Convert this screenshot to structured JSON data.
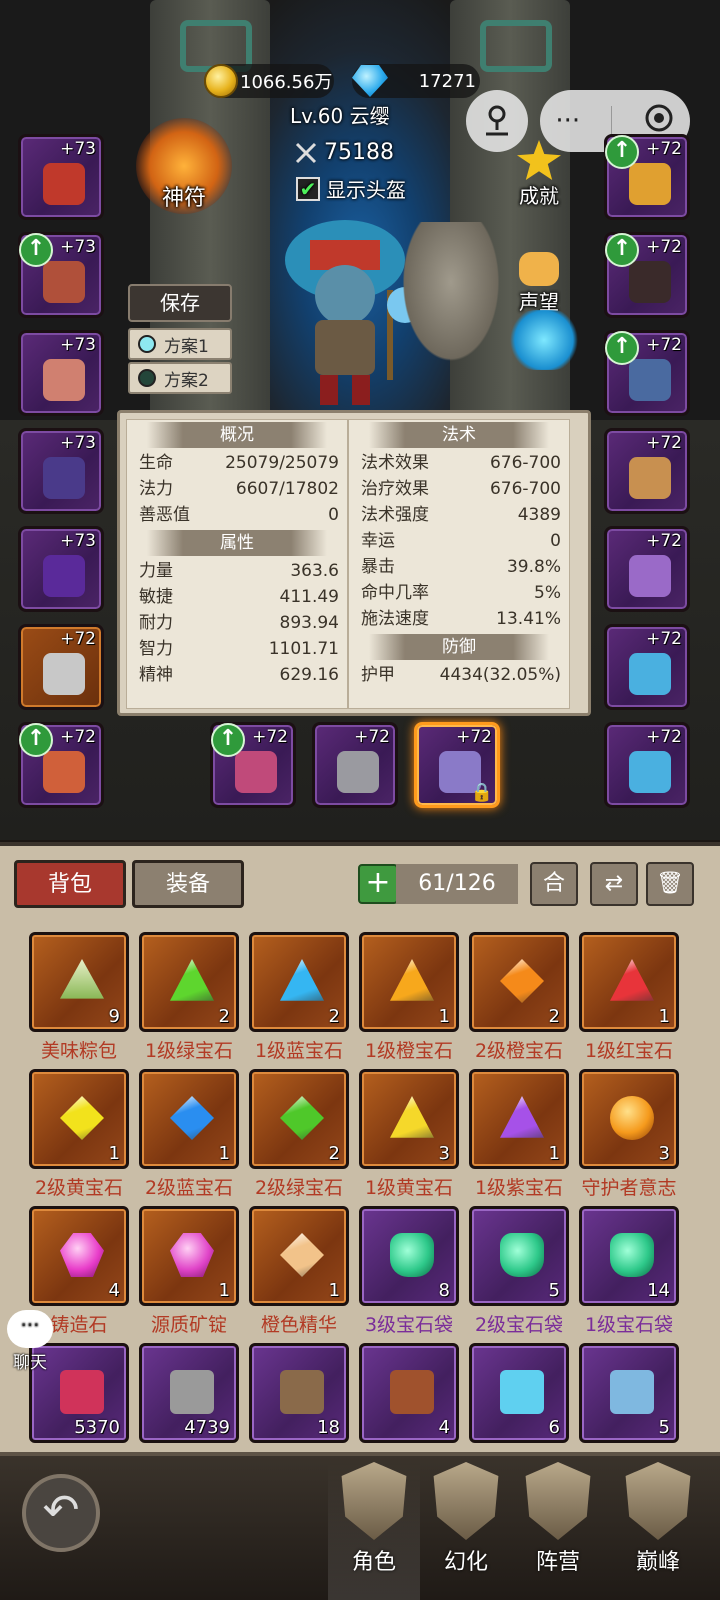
{
  "currency": {
    "gold": "1066.56万",
    "diamond": "17271"
  },
  "player": {
    "level_name": "Lv.60 云缨",
    "power": "75188",
    "show_helmet_label": "显示头盔"
  },
  "buttons": {
    "talisman": "神符",
    "achievement": "成就",
    "reputation": "声望",
    "save": "保存",
    "plan1": "方案1",
    "plan2": "方案2",
    "more": "···"
  },
  "left_equipment": [
    {
      "plus": "+73",
      "up": false,
      "rarity": "purple",
      "icon": "glove-icon"
    },
    {
      "plus": "+73",
      "up": true,
      "rarity": "purple",
      "icon": "necklace-icon"
    },
    {
      "plus": "+73",
      "up": false,
      "rarity": "purple",
      "icon": "bracer-icon"
    },
    {
      "plus": "+73",
      "up": false,
      "rarity": "purple",
      "icon": "armor-icon"
    },
    {
      "plus": "+73",
      "up": false,
      "rarity": "purple",
      "icon": "cape-icon"
    },
    {
      "plus": "+72",
      "up": false,
      "rarity": "orange",
      "icon": "bracelet-icon"
    },
    {
      "plus": "+72",
      "up": true,
      "rarity": "purple",
      "icon": "gauntlet-icon"
    }
  ],
  "right_equipment": [
    {
      "plus": "+72",
      "up": true,
      "rarity": "purple",
      "icon": "shoulder-icon"
    },
    {
      "plus": "+72",
      "up": true,
      "rarity": "purple",
      "icon": "pants-icon"
    },
    {
      "plus": "+72",
      "up": true,
      "rarity": "purple",
      "icon": "boots-icon"
    },
    {
      "plus": "+72",
      "up": false,
      "rarity": "purple",
      "icon": "ring-icon"
    },
    {
      "plus": "+72",
      "up": false,
      "rarity": "purple",
      "icon": "ring2-icon"
    },
    {
      "plus": "+72",
      "up": false,
      "rarity": "purple",
      "icon": "amulet-icon"
    },
    {
      "plus": "+72",
      "up": false,
      "rarity": "purple",
      "icon": "amulet2-icon"
    }
  ],
  "weapons": [
    {
      "plus": "+72",
      "up": true,
      "icon": "sword-icon"
    },
    {
      "plus": "+72",
      "up": false,
      "icon": "dagger-icon"
    },
    {
      "plus": "+72",
      "up": false,
      "icon": "staff-icon",
      "selected": true,
      "locked": true
    }
  ],
  "stats": {
    "overview_title": "概况",
    "overview": [
      {
        "label": "生命",
        "value": "25079/25079"
      },
      {
        "label": "法力",
        "value": "6607/17802"
      },
      {
        "label": "善恶值",
        "value": "0"
      }
    ],
    "attributes_title": "属性",
    "attributes": [
      {
        "label": "力量",
        "value": "363.6"
      },
      {
        "label": "敏捷",
        "value": "411.49"
      },
      {
        "label": "耐力",
        "value": "893.94"
      },
      {
        "label": "智力",
        "value": "1101.71"
      },
      {
        "label": "精神",
        "value": "629.16"
      }
    ],
    "magic_title": "法术",
    "magic": [
      {
        "label": "法术效果",
        "value": "676-700"
      },
      {
        "label": "治疗效果",
        "value": "676-700"
      },
      {
        "label": "法术强度",
        "value": "4389"
      },
      {
        "label": "幸运",
        "value": "0"
      },
      {
        "label": "暴击",
        "value": "39.8%"
      },
      {
        "label": "命中几率",
        "value": "5%"
      },
      {
        "label": "施法速度",
        "value": "13.41%"
      }
    ],
    "defense_title": "防御",
    "defense": [
      {
        "label": "护甲",
        "value": "4434(32.05%)"
      }
    ]
  },
  "bag": {
    "tab_bag": "背包",
    "tab_equip": "装备",
    "capacity": "61/126",
    "tool_merge": "合",
    "items": [
      {
        "name": "美味粽包",
        "count": "9",
        "rarity": "orange",
        "icon": "zongzi-icon",
        "color": "#7fb24a",
        "shape": "food"
      },
      {
        "name": "1级绿宝石",
        "count": "2",
        "rarity": "orange",
        "icon": "green-gem-icon",
        "color": "#5ed62e",
        "shape": "tri"
      },
      {
        "name": "1级蓝宝石",
        "count": "2",
        "rarity": "orange",
        "icon": "blue-gem-icon",
        "color": "#35b6f2",
        "shape": "tri"
      },
      {
        "name": "1级橙宝石",
        "count": "1",
        "rarity": "orange",
        "icon": "orange-gem-icon",
        "color": "#f7a81c",
        "shape": "tri"
      },
      {
        "name": "2级橙宝石",
        "count": "2",
        "rarity": "orange",
        "icon": "orange-gem-icon",
        "color": "#f58a1a",
        "shape": "dia"
      },
      {
        "name": "1级红宝石",
        "count": "1",
        "rarity": "orange",
        "icon": "red-gem-icon",
        "color": "#e8343a",
        "shape": "tri"
      },
      {
        "name": "2级黄宝石",
        "count": "1",
        "rarity": "orange",
        "icon": "yellow-gem-icon",
        "color": "#f2e21c",
        "shape": "dia"
      },
      {
        "name": "2级蓝宝石",
        "count": "1",
        "rarity": "orange",
        "icon": "blue-gem-icon",
        "color": "#2a8ef0",
        "shape": "dia"
      },
      {
        "name": "2级绿宝石",
        "count": "2",
        "rarity": "orange",
        "icon": "green-gem-icon",
        "color": "#4fc82a",
        "shape": "dia"
      },
      {
        "name": "1级黄宝石",
        "count": "3",
        "rarity": "orange",
        "icon": "yellow-gem-icon",
        "color": "#f5d82a",
        "shape": "tri"
      },
      {
        "name": "1级紫宝石",
        "count": "1",
        "rarity": "orange",
        "icon": "purple-gem-icon",
        "color": "#a651e8",
        "shape": "tri"
      },
      {
        "name": "守护者意志",
        "count": "3",
        "rarity": "orange",
        "icon": "orb-icon",
        "color": "#f59a1c",
        "shape": "orb"
      },
      {
        "name": "铸造石",
        "count": "4",
        "rarity": "orange",
        "icon": "forge-stone-icon",
        "color": "#e83cc9",
        "shape": "gem"
      },
      {
        "name": "源质矿锭",
        "count": "1",
        "rarity": "orange",
        "icon": "ore-ingot-icon",
        "color": "#e044c8",
        "shape": "gem"
      },
      {
        "name": "橙色精华",
        "count": "1",
        "rarity": "orange",
        "icon": "essence-icon",
        "color": "#f2c38a",
        "shape": "dia"
      },
      {
        "name": "3级宝石袋",
        "count": "8",
        "rarity": "purple",
        "icon": "gem-bag-icon",
        "color": "#2ec98a",
        "shape": "bag"
      },
      {
        "name": "2级宝石袋",
        "count": "5",
        "rarity": "purple",
        "icon": "gem-bag-icon",
        "color": "#2ec98a",
        "shape": "bag"
      },
      {
        "name": "1级宝石袋",
        "count": "14",
        "rarity": "purple",
        "icon": "gem-bag-icon",
        "color": "#2ec98a",
        "shape": "bag"
      },
      {
        "name": "",
        "count": "5370",
        "rarity": "purple",
        "icon": "rune-icon",
        "color": "#d0335a",
        "shape": "rune"
      },
      {
        "name": "",
        "count": "4739",
        "rarity": "purple",
        "icon": "banner-icon",
        "color": "#9a9a9a",
        "shape": "rune"
      },
      {
        "name": "",
        "count": "18",
        "rarity": "purple",
        "icon": "chest-icon",
        "color": "#8a6a4a",
        "shape": "rune"
      },
      {
        "name": "",
        "count": "4",
        "rarity": "purple",
        "icon": "bow-icon",
        "color": "#a0522d",
        "shape": "rune"
      },
      {
        "name": "",
        "count": "6",
        "rarity": "purple",
        "icon": "blade-icon",
        "color": "#5fd0f0",
        "shape": "rune"
      },
      {
        "name": "",
        "count": "5",
        "rarity": "purple",
        "icon": "sword-icon",
        "color": "#7fb8e0",
        "shape": "rune"
      }
    ]
  },
  "chat": {
    "label": "聊天"
  },
  "nav": [
    {
      "label": "角色",
      "icon": "helmet-icon",
      "active": true
    },
    {
      "label": "幻化",
      "icon": "transmog-icon",
      "active": false
    },
    {
      "label": "阵营",
      "icon": "faction-icon",
      "active": false
    },
    {
      "label": "巅峰",
      "icon": "peak-icon",
      "active": false
    }
  ],
  "colors": {
    "accent_red": "#a8382e",
    "label_red": "#b23a24",
    "label_purple": "#7a2d9a",
    "upgrade_green": "#2f9a3b"
  }
}
